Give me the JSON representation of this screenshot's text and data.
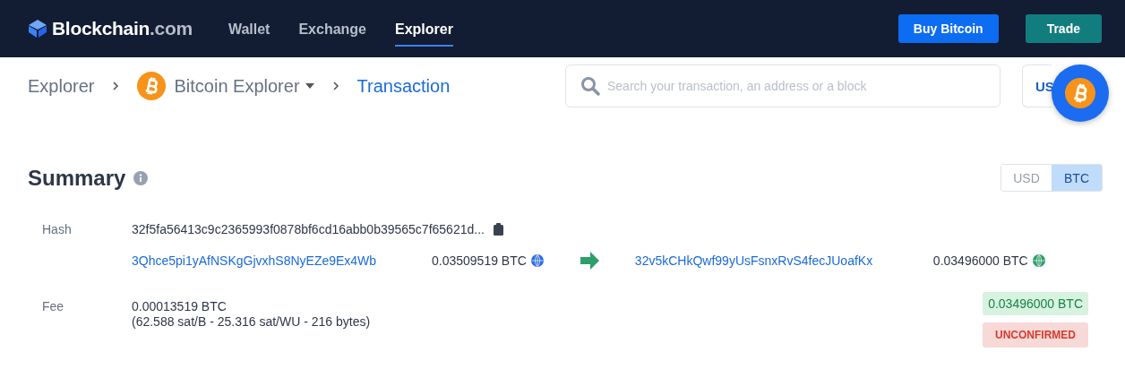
{
  "header": {
    "logo": {
      "name": "Blockchain",
      "suffix": ".com"
    },
    "nav": [
      {
        "label": "Wallet",
        "selected": false
      },
      {
        "label": "Exchange",
        "selected": false
      },
      {
        "label": "Explorer",
        "selected": true
      }
    ],
    "buttons": [
      {
        "label": "Buy Bitcoin",
        "kind": "primary"
      },
      {
        "label": "Trade",
        "kind": "teal"
      }
    ]
  },
  "breadcrumb": [
    {
      "label": "Explorer",
      "kind": "link"
    },
    {
      "label": "Bitcoin Explorer",
      "kind": "dropdown"
    },
    {
      "label": "Transaction",
      "kind": "current"
    }
  ],
  "search": {
    "placeholder": "Search your transaction, an address or a block"
  },
  "currency_button": {
    "label": "US"
  },
  "summary": {
    "title": "Summary",
    "toggle": [
      {
        "label": "USD",
        "selected": false
      },
      {
        "label": "BTC",
        "selected": true
      }
    ],
    "hash": {
      "label": "Hash",
      "value": "32f5fa56413c9c2365993f0878bf6cd16abb0b39565c7f65621d..."
    },
    "inputs": [
      {
        "address": "3Qhce5pi1yAfNSKgGjvxhS8NyEZe9Ex4Wb",
        "amount": "0.03509519 BTC",
        "color": "#2f6fe0"
      }
    ],
    "outputs": [
      {
        "address": "32v5kCHkQwf99yUsFsnxRvS4fecJUoafKx",
        "amount": "0.03496000 BTC",
        "color": "#2e9e6b"
      }
    ],
    "fee": {
      "label": "Fee",
      "value": "0.00013519 BTC",
      "detail": "(62.588 sat/B - 25.316 sat/WU - 216 bytes)"
    },
    "total": "0.03496000 BTC",
    "status": "UNCONFIRMED"
  }
}
